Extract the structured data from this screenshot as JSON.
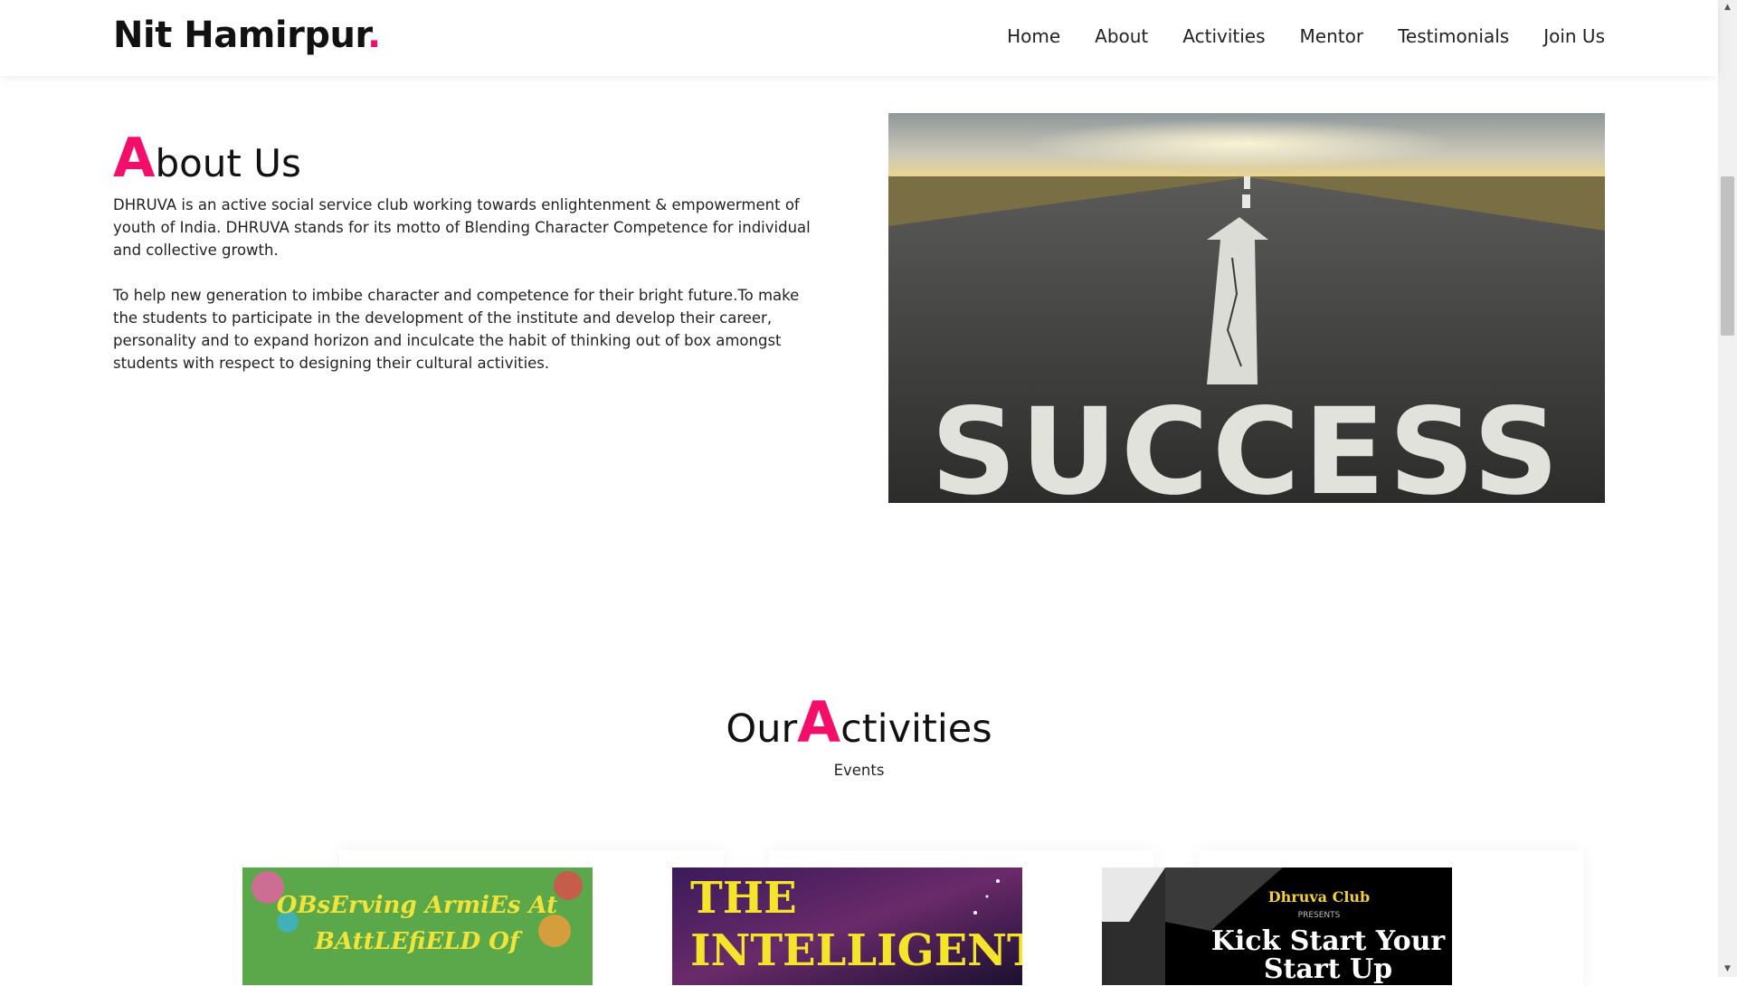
{
  "header": {
    "brand": "Nit Hamirpur",
    "brand_dot": ".",
    "nav": [
      "Home",
      "About",
      "Activities",
      "Mentor",
      "Testimonials",
      "Join Us"
    ]
  },
  "about": {
    "title_initial": "A",
    "title_rest": "bout Us",
    "para1": "DHRUVA is an active social service club working towards enlightenment & empowerment of youth of India. DHRUVA stands for its motto of Blending Character Competence for individual and collective growth.",
    "para2": "To help new generation to imbibe character and competence for their bright future.To make the students to participate in the development of the institute and develop their career, personality and to expand horizon and inculcate the habit of thinking out of box amongst students with respect to designing their cultural activities.",
    "image_text": "SUCCESS"
  },
  "activities": {
    "title_pre": "Our",
    "title_initial": "A",
    "title_rest": "ctivities",
    "subtitle": "Events",
    "posters": [
      {
        "line1": "OBsErving ArmiEs At",
        "line2": "BAttLEfiELD Of"
      },
      {
        "line1": "THE",
        "line2": "INTELLIGENT"
      },
      {
        "top": "Dhruva Club",
        "small": "PRESENTS",
        "line1": "Kick  Start Your",
        "line2": "Start Up"
      }
    ]
  },
  "colors": {
    "accent": "#f50d6a",
    "text": "#111111"
  }
}
